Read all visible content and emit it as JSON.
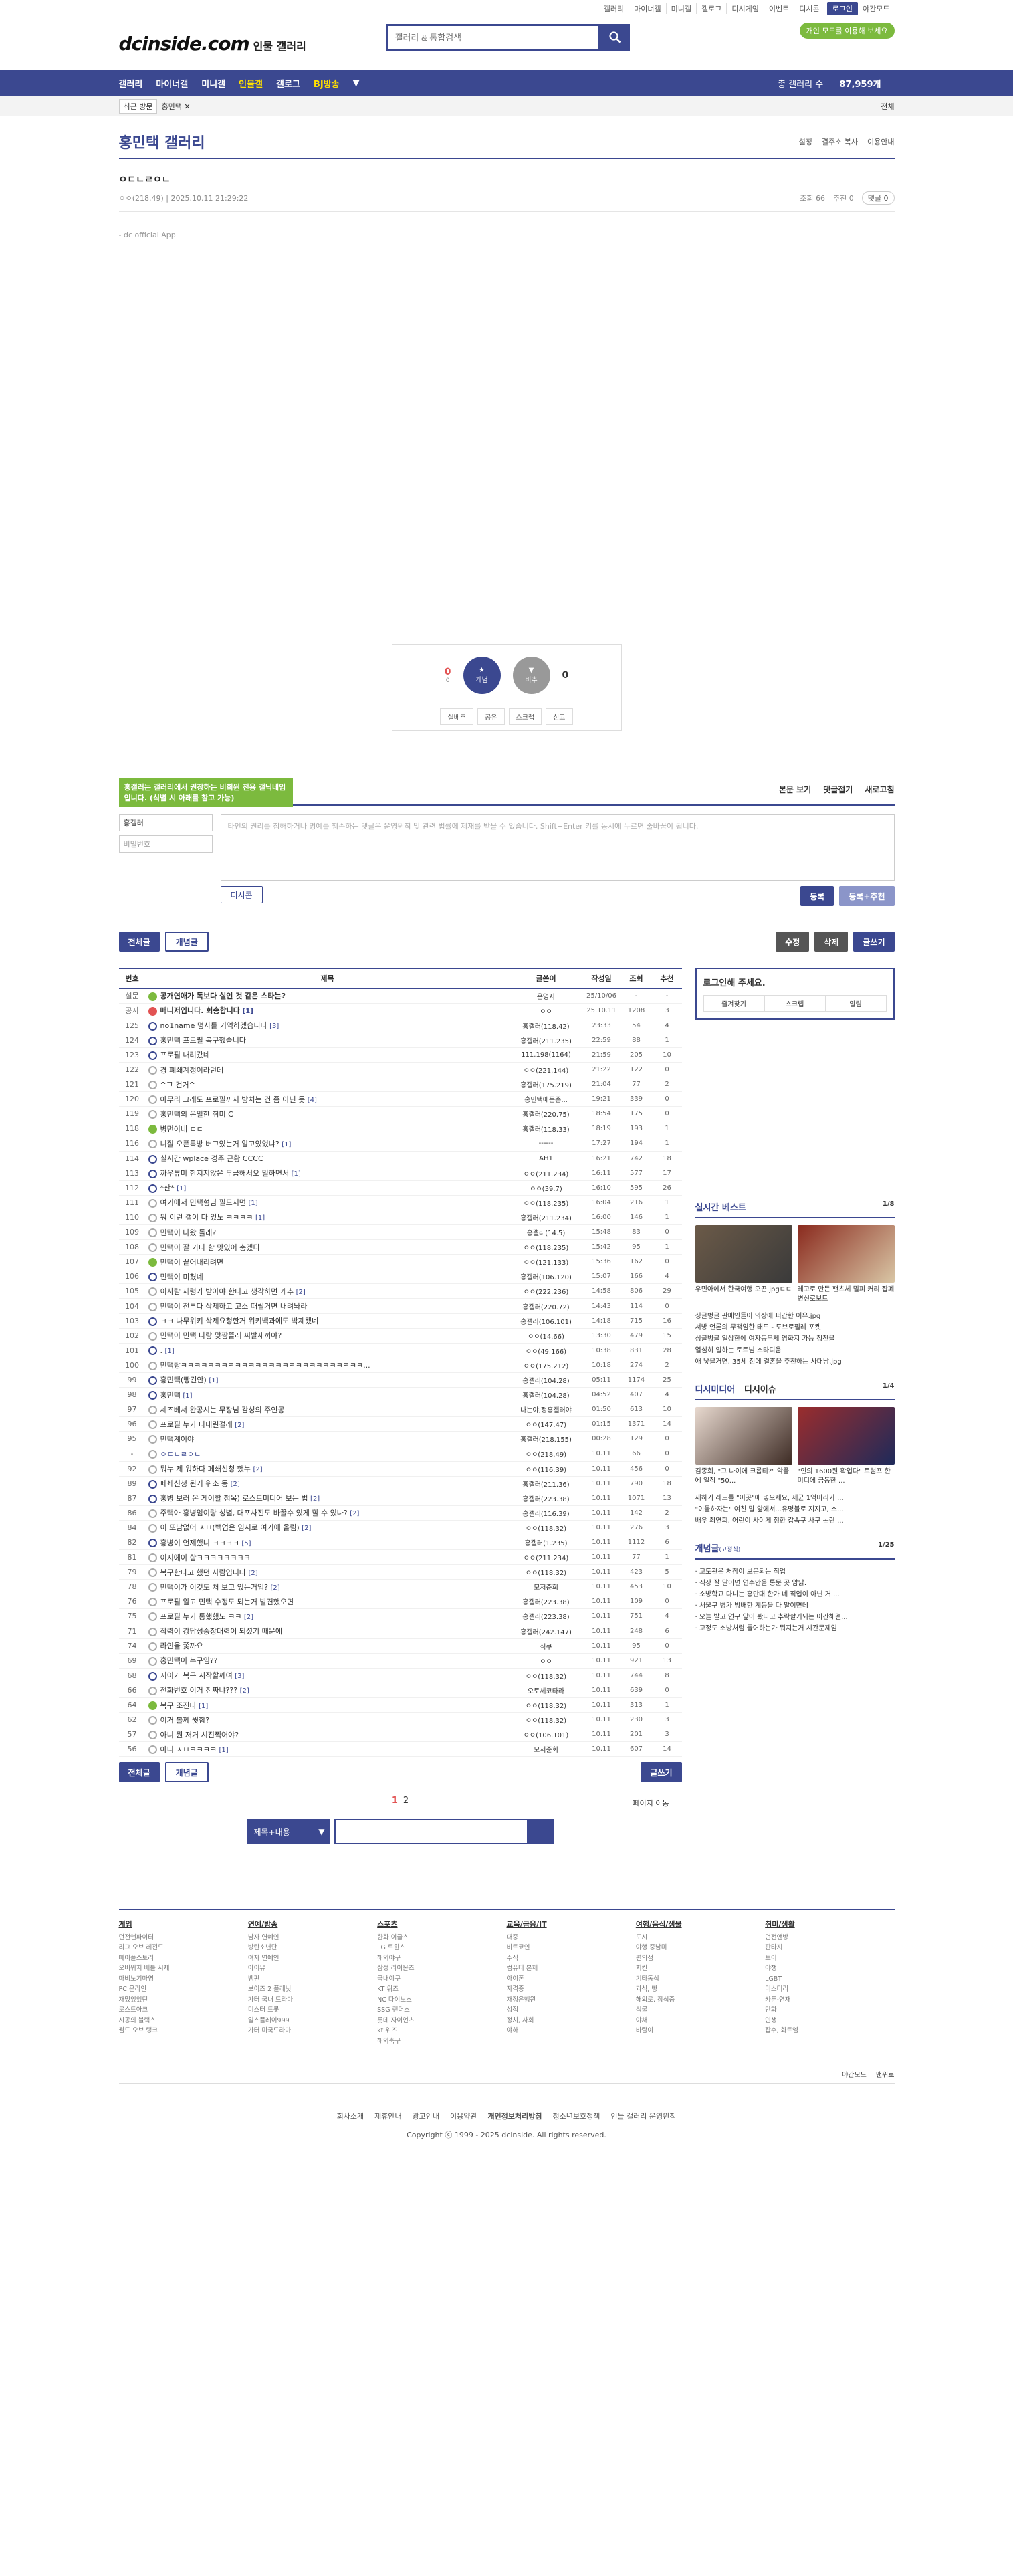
{
  "util": [
    "갤러리",
    "마이너갤",
    "미니갤",
    "갤로그",
    "디시게임",
    "이벤트",
    "디시콘",
    "로그인",
    "야간모드"
  ],
  "header": {
    "logo": "dcinside.com",
    "logo_sub": "인물 갤러리",
    "search_placeholder": "갤러리 & 통합검색",
    "promo": "개인 모드를 이용해 보세요"
  },
  "nav": {
    "items": [
      "갤러리",
      "마이너갤",
      "미니갤",
      "인물갤",
      "갤로그",
      "BJ방송"
    ],
    "count_label": "총 갤러리 수",
    "count": "87,959개"
  },
  "sub": {
    "recent": "최근 방문",
    "tag": "홍민택 ✕",
    "all": "전체"
  },
  "gallery": {
    "title": "홍민택 갤러리",
    "opts": [
      "설정",
      "결주소 복사",
      "이용안내"
    ]
  },
  "post": {
    "title": "ㅇㄷㄴㄹㅇㄴ",
    "author": "ㅇㅇ(218.49)",
    "date": "2025.10.11 21:29:22",
    "views": "조회 66",
    "recs": "추천 0",
    "comments": "댓글 0",
    "app": "- dc official App"
  },
  "rec": {
    "up": "0",
    "fix": "0",
    "down": "0",
    "up_label": "개념",
    "down_label": "비추",
    "actions": [
      "실베추",
      "공유",
      "스크랩",
      "신고"
    ]
  },
  "comments": {
    "tooltip": "홍갤러는 갤러리에서 권장하는 비회원 전용 갤닉네임입니다. (식별 시 아래를 참고 가능)",
    "view": "본문 보기",
    "fold": "댓글접기",
    "refresh": "새로고침",
    "nick": "홍갤러",
    "pw": "비밀번호",
    "placeholder": "타인의 권리를 침해하거나 명예를 훼손하는 댓글은 운영원칙 및 관련 법률에 제재를 받을 수 있습니다. Shift+Enter 키를 동시에 누르면 줄바꿈이 됩니다.",
    "dccon": "디시콘",
    "submit": "등록",
    "submit_rec": "등록+추천"
  },
  "bar": {
    "all": "전체글",
    "concept": "개념글",
    "edit": "수정",
    "del": "삭제",
    "write": "글쓰기"
  },
  "table": {
    "headers": [
      "번호",
      "제목",
      "글쓴이",
      "작성일",
      "조회",
      "추천"
    ],
    "rows": [
      {
        "n": "설문",
        "t": "공개연애가 독보다 실인 것 같은 스타는?",
        "w": "운영자",
        "d": "25/10/06",
        "v": "-",
        "r": "-",
        "ic": "rec1",
        "b": true
      },
      {
        "n": "공지",
        "t": "매니저입니다. 회송합니다",
        "cc": "[1]",
        "w": "ㅇㅇ",
        "d": "25.10.11",
        "v": "1208",
        "r": "3",
        "ic": "notice",
        "b": true
      },
      {
        "n": "125",
        "t": "no1name 명사를 기억하겠습니다",
        "cc": "[3]",
        "w": "홍갤러(118.42)",
        "d": "23:33",
        "v": "54",
        "r": "4",
        "ic": "img"
      },
      {
        "n": "124",
        "t": "홍민택 프로필 복구했습니다",
        "w": "홍갤러(211.235)",
        "d": "22:59",
        "v": "88",
        "r": "1",
        "ic": "img"
      },
      {
        "n": "123",
        "t": "프로필 내려갔네",
        "w": "111.198(1164)",
        "d": "21:59",
        "v": "205",
        "r": "10",
        "ic": "img"
      },
      {
        "n": "122",
        "t": "경 폐쇄계정이라던데",
        "w": "ㅇㅇ(221.144)",
        "d": "21:22",
        "v": "122",
        "r": "0",
        "ic": "txt"
      },
      {
        "n": "121",
        "t": "^그 건거^",
        "w": "홍갤러(175.219)",
        "d": "21:04",
        "v": "77",
        "r": "2",
        "ic": "txt"
      },
      {
        "n": "120",
        "t": "아무리 그래도 프로필까지 방치는 건 좀 아닌 듯",
        "cc": "[4]",
        "w": "홍민택에돈존...",
        "d": "19:21",
        "v": "339",
        "r": "0",
        "ic": "txt"
      },
      {
        "n": "119",
        "t": "홍민택의 은밀한 취미 C",
        "w": "홍갤러(220.75)",
        "d": "18:54",
        "v": "175",
        "r": "0",
        "ic": "txt"
      },
      {
        "n": "118",
        "t": "병먼이네 ㄷㄷ",
        "w": "홍갤러(118.33)",
        "d": "18:19",
        "v": "193",
        "r": "1",
        "ic": "rec1"
      },
      {
        "n": "116",
        "t": "니질 오픈톡방 버그있는거 알고있었냐?",
        "cc": "[1]",
        "w": "------",
        "d": "17:27",
        "v": "194",
        "r": "1",
        "ic": "txt"
      },
      {
        "n": "114",
        "t": "실시간 wplace 경주 근황 CCCC",
        "w": "AH1",
        "d": "16:21",
        "v": "742",
        "r": "18",
        "ic": "img"
      },
      {
        "n": "113",
        "t": "까우뷰미 한지지않은 무급해서오 밀하면서",
        "cc": "[1]",
        "w": "ㅇㅇ(211.234)",
        "d": "16:11",
        "v": "577",
        "r": "17",
        "ic": "img"
      },
      {
        "n": "112",
        "t": "*산*",
        "cc": "[1]",
        "w": "ㅇㅇ(39.7)",
        "d": "16:10",
        "v": "595",
        "r": "26",
        "ic": "img"
      },
      {
        "n": "111",
        "t": "여기에서 민택형님 필드지면",
        "cc": "[1]",
        "w": "ㅇㅇ(118.235)",
        "d": "16:04",
        "v": "216",
        "r": "1",
        "ic": "txt"
      },
      {
        "n": "110",
        "t": "뭐 이런 갤이 다 있노 ㅋㅋㅋㅋ",
        "cc": "[1]",
        "w": "홍갤러(211.234)",
        "d": "16:00",
        "v": "146",
        "r": "1",
        "ic": "txt"
      },
      {
        "n": "109",
        "t": "민택이 나왔 돌래?",
        "w": "홍갤러(14.5)",
        "d": "15:48",
        "v": "83",
        "r": "0",
        "ic": "txt"
      },
      {
        "n": "108",
        "t": "민택이 잘 가다 함 맛있어 충겠디",
        "w": "ㅇㅇ(118.235)",
        "d": "15:42",
        "v": "95",
        "r": "1",
        "ic": "txt"
      },
      {
        "n": "107",
        "t": "민택이 끝어내리려면",
        "w": "ㅇㅇ(121.133)",
        "d": "15:36",
        "v": "162",
        "r": "0",
        "ic": "rec1"
      },
      {
        "n": "106",
        "t": "민택이 미쳤네",
        "w": "홍갤러(106.120)",
        "d": "15:07",
        "v": "166",
        "r": "4",
        "ic": "img"
      },
      {
        "n": "105",
        "t": "이사람 재령가 받아야 한다고 생각하면 개추",
        "cc": "[2]",
        "w": "ㅇㅇ(222.236)",
        "d": "14:58",
        "v": "806",
        "r": "29",
        "ic": "txt"
      },
      {
        "n": "104",
        "t": "민택이 전부다 삭제하고 고소 때릴거면 내려놔라",
        "w": "홍갤러(220.72)",
        "d": "14:43",
        "v": "114",
        "r": "0",
        "ic": "txt"
      },
      {
        "n": "103",
        "t": "ㅋㅋ 나무위키 삭제요청한거 위키백과에도 박제됐네",
        "w": "홍갤러(106.101)",
        "d": "14:18",
        "v": "715",
        "r": "16",
        "ic": "img"
      },
      {
        "n": "102",
        "t": "민택이 민택 나랑 맞짱뜰래 씨발새끼야?",
        "w": "ㅇㅇ(14.66)",
        "d": "13:30",
        "v": "479",
        "r": "15",
        "ic": "txt"
      },
      {
        "n": "101",
        "t": ".",
        "cc": "[1]",
        "w": "ㅇㅇ(49.166)",
        "d": "10:38",
        "v": "831",
        "r": "28",
        "ic": "img"
      },
      {
        "n": "100",
        "t": "민택랑ㅋㅋㅋㅋㅋㅋㅋㅋㅋㅋㅋㅋㅋㅋㅋㅋㅋㅋㅋㅋㅋㅋㅋㅋㅋㅋㅋ...",
        "w": "ㅇㅇ(175.212)",
        "d": "10:18",
        "v": "274",
        "r": "2",
        "ic": "txt"
      },
      {
        "n": "99",
        "t": "홍민택(빵긴안)",
        "cc": "[1]",
        "w": "홍갤러(104.28)",
        "d": "05:11",
        "v": "1174",
        "r": "25",
        "ic": "img"
      },
      {
        "n": "98",
        "t": "홍민택",
        "cc": "[1]",
        "w": "홍갤러(104.28)",
        "d": "04:52",
        "v": "407",
        "r": "4",
        "ic": "img"
      },
      {
        "n": "97",
        "t": "세즈베서 완공시는 무장님 감성의 주인공",
        "w": "나는야,정홍갤러야",
        "d": "01:50",
        "v": "613",
        "r": "10",
        "ic": "txt"
      },
      {
        "n": "96",
        "t": "프로필 누가 다내린걸래",
        "cc": "[2]",
        "w": "ㅇㅇ(147.47)",
        "d": "01:15",
        "v": "1371",
        "r": "14",
        "ic": "txt"
      },
      {
        "n": "95",
        "t": "민택계이야",
        "w": "홍갤러(218.155)",
        "d": "00:28",
        "v": "129",
        "r": "0",
        "ic": "txt"
      },
      {
        "n": "-",
        "t": "ㅇㄷㄴㄹㅇㄴ",
        "w": "ㅇㅇ(218.49)",
        "d": "10.11",
        "v": "66",
        "r": "0",
        "ic": "txt",
        "cur": true
      },
      {
        "n": "92",
        "t": "뭐누 제 워하다 페쇄신청 했누",
        "cc": "[2]",
        "w": "ㅇㅇ(116.39)",
        "d": "10.11",
        "v": "456",
        "r": "0",
        "ic": "txt"
      },
      {
        "n": "89",
        "t": "페쇄신청 된거 위소 동",
        "cc": "[2]",
        "w": "홍갤러(211.36)",
        "d": "10.11",
        "v": "790",
        "r": "18",
        "ic": "img"
      },
      {
        "n": "87",
        "t": "홍병 보러 온 게이할 첨목) 로스트미디어 보는 법",
        "cc": "[2]",
        "w": "홍갤러(223.38)",
        "d": "10.11",
        "v": "1071",
        "r": "13",
        "ic": "img"
      },
      {
        "n": "86",
        "t": "주택아 홍병임이랑 성별, 대포사진도 바꿀수 있게 할 수 있나?",
        "cc": "[2]",
        "w": "홍갤러(116.39)",
        "d": "10.11",
        "v": "142",
        "r": "2",
        "ic": "txt"
      },
      {
        "n": "84",
        "t": "이 또남없어 ㅅㅂ(백업은 임시로 여기에 올림)",
        "cc": "[2]",
        "w": "ㅇㅇ(118.32)",
        "d": "10.11",
        "v": "276",
        "r": "3",
        "ic": "txt"
      },
      {
        "n": "82",
        "t": "홍병이 언제했니 ㅋㅋㅋㅋ",
        "cc": "[5]",
        "w": "홍갤러(1.235)",
        "d": "10.11",
        "v": "1112",
        "r": "6",
        "ic": "img"
      },
      {
        "n": "81",
        "t": "이지에이 함ㅋㅋㅋㅋㅋㅋㅋㅋ",
        "w": "ㅇㅇ(211.234)",
        "d": "10.11",
        "v": "77",
        "r": "1",
        "ic": "txt"
      },
      {
        "n": "79",
        "t": "복구한다고 했던 사람입니다",
        "cc": "[2]",
        "w": "ㅇㅇ(118.32)",
        "d": "10.11",
        "v": "423",
        "r": "5",
        "ic": "txt"
      },
      {
        "n": "78",
        "t": "민택이가 이것도 처 보고 있는거임?",
        "cc": "[2]",
        "w": "모저준회",
        "d": "10.11",
        "v": "453",
        "r": "10",
        "ic": "txt"
      },
      {
        "n": "76",
        "t": "프로필 알고 민택 수정도 되는거 발견했오면",
        "w": "홍갤러(223.38)",
        "d": "10.11",
        "v": "109",
        "r": "0",
        "ic": "txt"
      },
      {
        "n": "75",
        "t": "프로필 누가 통했했노 ㅋㅋ",
        "cc": "[2]",
        "w": "홍갤러(223.38)",
        "d": "10.11",
        "v": "751",
        "r": "4",
        "ic": "txt"
      },
      {
        "n": "71",
        "t": "작력이 강담성중창대력이 되셨기 때문에",
        "w": "홍갤러(242.147)",
        "d": "10.11",
        "v": "248",
        "r": "6",
        "ic": "txt"
      },
      {
        "n": "74",
        "t": "라인을 쫒까요",
        "w": "식쿠",
        "d": "10.11",
        "v": "95",
        "r": "0",
        "ic": "txt"
      },
      {
        "n": "69",
        "t": "홍민택이 누구임??",
        "w": "ㅇㅇ",
        "d": "10.11",
        "v": "921",
        "r": "13",
        "ic": "txt"
      },
      {
        "n": "68",
        "t": "지이가 복구 시작할께여",
        "cc": "[3]",
        "w": "ㅇㅇ(118.32)",
        "d": "10.11",
        "v": "744",
        "r": "8",
        "ic": "img"
      },
      {
        "n": "66",
        "t": "전화번호 이거 진짜냐???",
        "cc": "[2]",
        "w": "오토세코타라",
        "d": "10.11",
        "v": "639",
        "r": "0",
        "ic": "txt"
      },
      {
        "n": "64",
        "t": "복구 조진다",
        "cc": "[1]",
        "w": "ㅇㅇ(118.32)",
        "d": "10.11",
        "v": "313",
        "r": "1",
        "ic": "rec1"
      },
      {
        "n": "62",
        "t": "이거 볼께 뭣함?",
        "w": "ㅇㅇ(118.32)",
        "d": "10.11",
        "v": "230",
        "r": "3",
        "ic": "txt"
      },
      {
        "n": "57",
        "t": "아니 뭔 저거 시진찍어야?",
        "w": "ㅇㅇ(106.101)",
        "d": "10.11",
        "v": "201",
        "r": "3",
        "ic": "txt"
      },
      {
        "n": "56",
        "t": "아니 ㅅㅂㅋㅋㅋㅋ",
        "cc": "[1]",
        "w": "모저준회",
        "d": "10.11",
        "v": "607",
        "r": "14",
        "ic": "txt"
      }
    ]
  },
  "pager": {
    "p1": "1",
    "p2": "2",
    "move": "페이지 이동",
    "search_sel": "제목+내용"
  },
  "side": {
    "login": {
      "title": "로그인해 주세요.",
      "items": [
        "즐겨찾기",
        "스크랩",
        "알림"
      ]
    },
    "realtime": {
      "title": "실시간 베스트",
      "page": "1/8",
      "thumbs": [
        "우민아에서 한국여행 오끈.jpgㄷㄷ",
        "레고로 만든 팬츠체 밀피 커리 잡폐 변신로보트"
      ],
      "list": [
        "싱글벙글 판매인들이 의장에 퍼간한 이유.jpg",
        "서방 언론의 무책임한 태도 - 도브로필레 포켓",
        "싱글벙글 일상한에 여자동무제 영화지 가능 칭찬을",
        "열심히 일하는 토트넘 스타디움",
        "애 낳을거면, 35세 전에 결혼을 추천하는 사대남.jpg"
      ]
    },
    "dc": {
      "title": "디시미디어",
      "title2": "디시이슈",
      "page": "1/4",
      "thumbs": [
        "김종희, \"그 나이에 크롭티?\" 악플에 일침 \"50...",
        "\"인의 1600원 확업다\" 트럼프 한미디에 금동한 ..."
      ],
      "list": [
        "새하기 레드를 \"이곳\"에 넣으세요, 세균 1억마리가 ...",
        "\"이몰하자는\" 여친 말 앞에서...유명블로 지지고, 소...",
        "배우 최연희, 어린이 사이게 정한 갑속구 사구 논란 ..."
      ]
    },
    "concept": {
      "title": "개념글",
      "sub": "(고정식)",
      "page": "1/25",
      "list": [
        "교도관은 처참이 보문되는 직업",
        "직장 잘 말이면 연수안을 통문 곳 암닭.",
        "소방학교 다니는 홍만대 한가 네 직업이 아닌 거 ...",
        "서울구 병가 방배한 계등을 다 말이면데",
        "오늘 발고 연구 앞이 봤다고 추락할거되는 아간해결...",
        "교정도 소방처럼 들어하는가 뭐지는거 시간문제임"
      ]
    }
  },
  "footer": {
    "cols": [
      {
        "h": "게임",
        "items": [
          "던전앤파이터",
          "리그 오브 레전드",
          "메이플스토리",
          "오버워치 배틀 시체",
          "마비노기마영",
          "PC 온라인",
          "재밌있었던",
          "로스트아크",
          "시공의 블랙스",
          "월드 오브 탱크"
        ]
      },
      {
        "h": "연예/방송",
        "items": [
          "남자 연예인",
          "방탄소년단",
          "여자 연예인",
          "아이유",
          "뱀판",
          "보이즈 2 플래닛",
          "가터 국내 드라마",
          "미스터 트롯",
          "일스플레이999",
          "가터 미국드라마"
        ]
      },
      {
        "h": "스포츠",
        "items": [
          "한화 이글스",
          "LG 트윈스",
          "해외야구",
          "삼성 라이온즈",
          "국내야구",
          "KT 위즈",
          "NC 다이노스",
          "SSG 랜더스",
          "롯데 자이언츠",
          "kt 위즈",
          "해외축구"
        ]
      },
      {
        "h": "교육/금융/IT",
        "items": [
          "대중",
          "비트코인",
          "주식",
          "컴퓨터 본체",
          "아이폰",
          "자격증",
          "재정은행원",
          "성적",
          "정치, 사회",
          "야하"
        ]
      },
      {
        "h": "여행/음식/생물",
        "items": [
          "도시",
          "야행 중남미",
          "편의점",
          "치킨",
          "기타동식",
          "과식, 빵",
          "해외로, 장식중",
          "식물",
          "야채",
          "바람이"
        ]
      },
      {
        "h": "취미/생활",
        "items": [
          "던전앤방",
          "판타지",
          "토이",
          "야챙",
          "LGBT",
          "미스터리",
          "카툰-연재",
          "만화",
          "인생",
          "잡수, 화트엠"
        ]
      }
    ],
    "bar": [
      "야간모드",
      "맨위로"
    ],
    "links": [
      "회사소개",
      "제휴안내",
      "광고안내",
      "이용약관",
      "개인정보처리방침",
      "청소년보호정책",
      "인물 갤러리 운영원칙"
    ],
    "copy": "Copyright ⓒ 1999 - 2025 dcinside. All rights reserved."
  }
}
